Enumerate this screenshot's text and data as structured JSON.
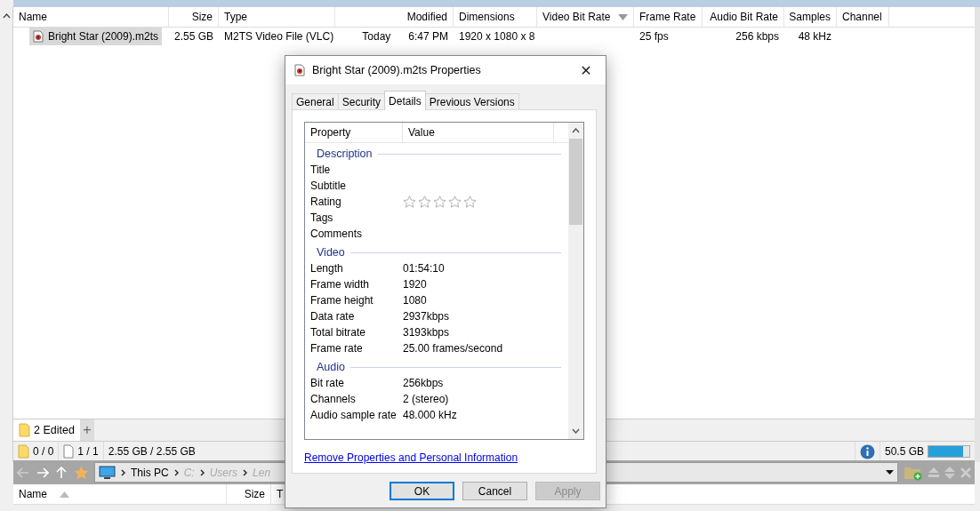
{
  "file_list": {
    "columns": [
      {
        "label": "Name",
        "sorted": false
      },
      {
        "label": "Size",
        "sorted": false
      },
      {
        "label": "Type",
        "sorted": false
      },
      {
        "label": "Modified",
        "sorted": false
      },
      {
        "label": "Dimensions",
        "sorted": false
      },
      {
        "label": "Video Bit Rate",
        "sorted": true,
        "descending": true
      },
      {
        "label": "Frame Rate",
        "sorted": false
      },
      {
        "label": "Audio Bit Rate",
        "sorted": false
      },
      {
        "label": "Samples",
        "sorted": false
      },
      {
        "label": "Channel",
        "sorted": false
      }
    ],
    "rows": [
      {
        "selected": true,
        "cells": [
          "Bright Star (2009).m2ts",
          "2.55 GB",
          "M2TS Video File (VLC)",
          "Today      6:47 PM",
          "1920 x 1080 x 8",
          "",
          "25 fps",
          "256 kbps",
          "48 kHz",
          ""
        ]
      }
    ]
  },
  "tab_bar": {
    "tabs": [
      {
        "label": "2 Edited",
        "selected": true
      }
    ],
    "add_tab": "+"
  },
  "status_bar": {
    "folders": "0 / 0",
    "files": "1 / 1",
    "size": "2.55 GB / 2.55 GB",
    "free_space": "50.5 GB",
    "level": 0.85
  },
  "lower_pane": {
    "breadcrumb": [
      {
        "label": "This PC",
        "dimmed": false
      },
      {
        "label": "C:",
        "dimmed": true
      },
      {
        "label": "Users",
        "dimmed": true
      },
      {
        "label": "Len",
        "dimmed": true
      }
    ],
    "columns": [
      {
        "label": "Name",
        "sorted": true,
        "descending": false
      },
      {
        "label": "Size",
        "sorted": false
      },
      {
        "label": "T",
        "sorted": false
      }
    ]
  },
  "dialog": {
    "title": "Bright Star (2009).m2ts Properties",
    "close": "✕",
    "tabs": [
      {
        "label": "General",
        "selected": false
      },
      {
        "label": "Security",
        "selected": false
      },
      {
        "label": "Details",
        "selected": true
      },
      {
        "label": "Previous Versions",
        "selected": false
      }
    ],
    "list_columns": [
      "Property",
      "Value"
    ],
    "groups": [
      {
        "heading": "Description",
        "rows": [
          {
            "kind": "text",
            "property": "Title"
          },
          {
            "kind": "text",
            "property": "Subtitle"
          },
          {
            "kind": "rating",
            "property": "Rating",
            "stars": 0
          },
          {
            "kind": "text",
            "property": "Tags"
          },
          {
            "kind": "text",
            "property": "Comments"
          }
        ]
      },
      {
        "heading": "Video",
        "rows": [
          {
            "kind": "text",
            "property": "Length",
            "value": "01:54:10"
          },
          {
            "kind": "text",
            "property": "Frame width",
            "value": "1920"
          },
          {
            "kind": "text",
            "property": "Frame height",
            "value": "1080"
          },
          {
            "kind": "text",
            "property": "Data rate",
            "value": "2937kbps"
          },
          {
            "kind": "text",
            "property": "Total bitrate",
            "value": "3193kbps"
          },
          {
            "kind": "text",
            "property": "Frame rate",
            "value": "25.00 frames/second"
          }
        ]
      },
      {
        "heading": "Audio",
        "rows": [
          {
            "kind": "text",
            "property": "Bit rate",
            "value": "256kbps"
          },
          {
            "kind": "text",
            "property": "Channels",
            "value": "2 (stereo)"
          },
          {
            "kind": "text",
            "property": "Audio sample rate",
            "value": "48.000 kHz"
          }
        ]
      }
    ],
    "link": "Remove Properties and Personal Information",
    "buttons": [
      {
        "label": "OK",
        "default": true,
        "disabled": false
      },
      {
        "label": "Cancel",
        "default": false,
        "disabled": false
      },
      {
        "label": "Apply",
        "default": false,
        "disabled": true
      }
    ]
  }
}
